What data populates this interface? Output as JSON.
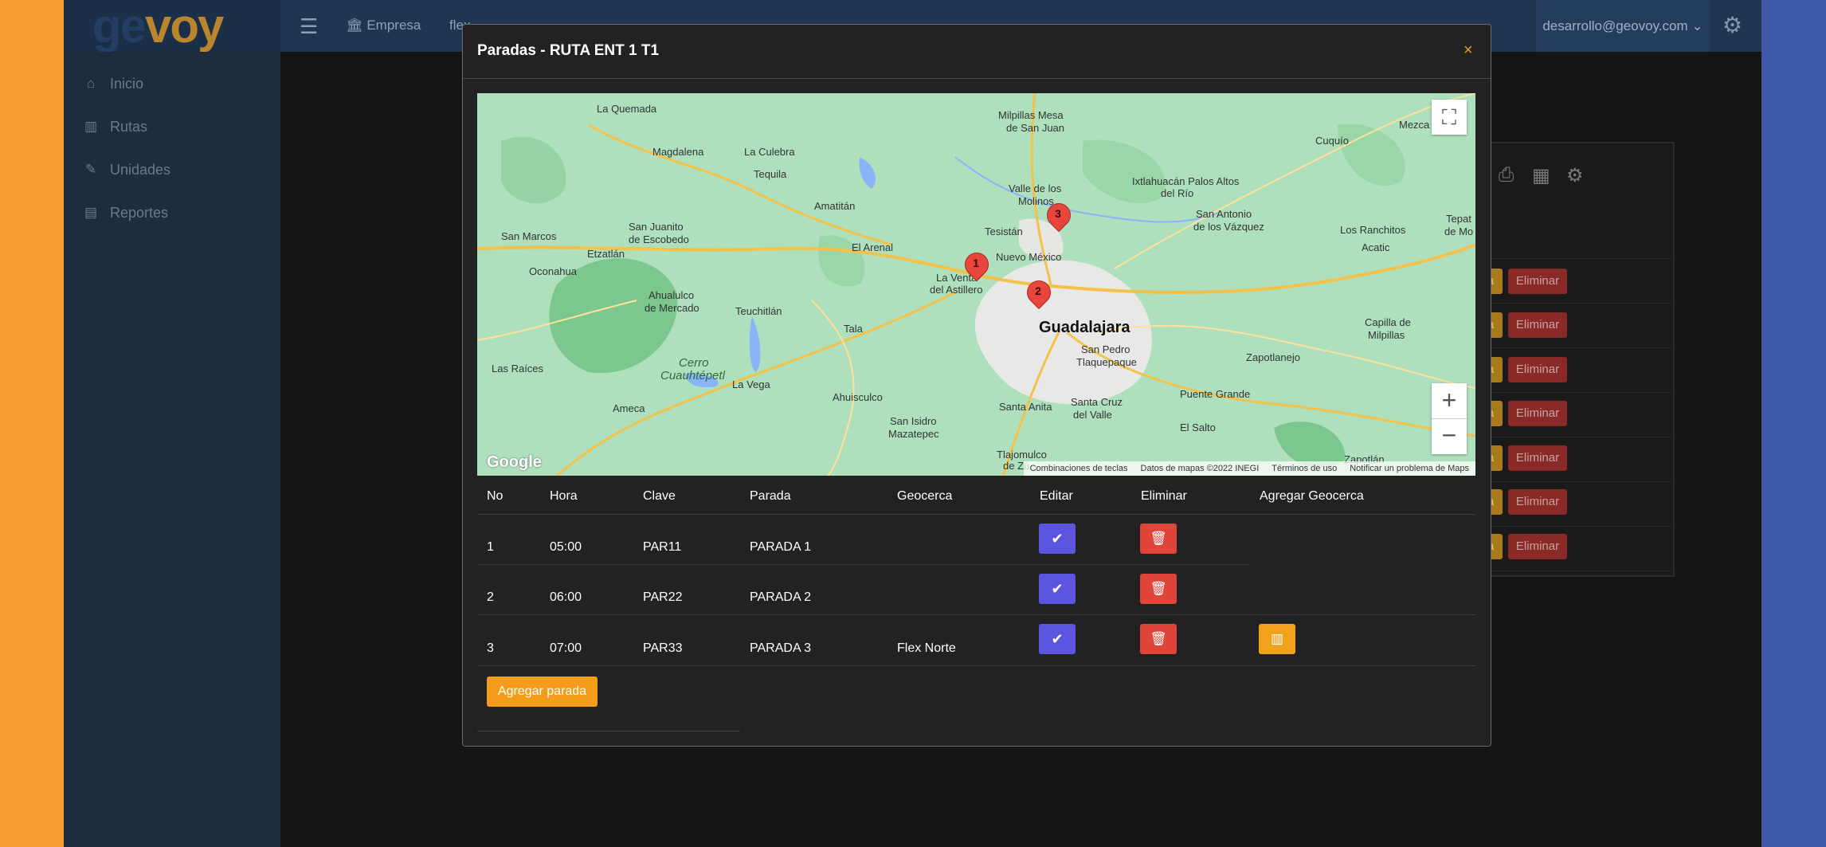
{
  "brand": {
    "logo_text_a": "ge",
    "logo_text_b": "v",
    "logo_text_c": "oy"
  },
  "topbar": {
    "empresa_label": "Empresa",
    "flex_label": "flex",
    "user_email": "desarrollo@geovoy.com",
    "user_caret": "⌄"
  },
  "sidebar": {
    "items": [
      {
        "label": "Inicio",
        "icon": "home-icon"
      },
      {
        "label": "Rutas",
        "icon": "map-icon"
      },
      {
        "label": "Unidades",
        "icon": "pencil-icon"
      },
      {
        "label": "Reportes",
        "icon": "clipboard-icon"
      }
    ]
  },
  "background_table": {
    "partial_button_label": "a",
    "delete_label": "Eliminar"
  },
  "modal": {
    "title": "Paradas - RUTA ENT 1 T1",
    "close_label": "×",
    "map": {
      "markers": [
        "1",
        "2",
        "3"
      ],
      "labels": {
        "guadalajara": "Guadalajara",
        "la_quemada": "La Quemada",
        "milpillas": "Milpillas Mesa",
        "de_san_juan": "de San Juan",
        "magdalena": "Magdalena",
        "la_culebra": "La Culebra",
        "tequila": "Tequila",
        "amatitan": "Amatitán",
        "valle_molinos": "Valle de los",
        "molinos": "Molinos",
        "ixtlahuacan": "Ixtlahuacán Palos Altos",
        "del_rio": "del Río",
        "cuquio": "Cuquío",
        "mezca": "Mezca",
        "san_juanito": "San Juanito",
        "de_escobedo": "de Escobedo",
        "san_marcos": "San Marcos",
        "etzatlan": "Etzatlán",
        "el_arenal": "El Arenal",
        "tesistan": "Tesistán",
        "nuevo_mexico": "Nuevo México",
        "san_antonio": "San Antonio",
        "de_los_vazquez": "de los Vázquez",
        "los_ranchitos": "Los Ranchitos",
        "acatic": "Acatic",
        "tepat": "Tepat",
        "de_mo": "de Mo",
        "oconahua": "Oconahua",
        "ahualulco": "Ahualulco",
        "de_mercado": "de Mercado",
        "teuchitlan": "Teuchitlán",
        "la_venta": "La Venta",
        "del_astillero": "del Astillero",
        "tala": "Tala",
        "capilla": "Capilla de",
        "milpillas2": "Milpillas",
        "san_pedro": "San Pedro",
        "tlaquepaque": "Tlaquepaque",
        "zapotlanejo": "Zapotlanejo",
        "las_raices": "Las Raíces",
        "cerro": "Cerro",
        "cuauhtepetl": "Cuauhtépetl",
        "la_vega": "La Vega",
        "ahuisculco": "Ahuisculco",
        "santa_anita": "Santa Anita",
        "santa_cruz": "Santa Cruz",
        "del_valle": "del Valle",
        "puente_grande": "Puente Grande",
        "ameca": "Ameca",
        "san_isidro": "San Isidro",
        "mazatepec": "Mazatepec",
        "el_salto": "El Salto",
        "tlajomulco": "Tlajomulco",
        "de_zuniga": "de Zú",
        "zapotlan": "Zapotlán"
      },
      "google_logo": "Google",
      "attribution": [
        "Combinaciones de teclas",
        "Datos de mapas ©2022 INEGI",
        "Términos de uso",
        "Notificar un problema de Maps"
      ],
      "zoom_in_label": "+",
      "zoom_out_label": "−",
      "fullscreen_label": "⛶"
    },
    "table": {
      "headers": [
        "No",
        "Hora",
        "Clave",
        "Parada",
        "Geocerca",
        "Editar",
        "Eliminar",
        "Agregar Geocerca"
      ],
      "rows": [
        {
          "no": "1",
          "hora": "05:00",
          "clave": "PAR11",
          "parada": "PARADA 1",
          "geocerca": ""
        },
        {
          "no": "2",
          "hora": "06:00",
          "clave": "PAR22",
          "parada": "PARADA 2",
          "geocerca": ""
        },
        {
          "no": "3",
          "hora": "07:00",
          "clave": "PAR33",
          "parada": "PARADA 3",
          "geocerca": "Flex Norte"
        }
      ]
    },
    "add_button_label": "Agregar parada"
  },
  "icons": {
    "edit": "✔",
    "delete": "🗑",
    "geofence": "▥",
    "print": "⎙",
    "excel": "▦",
    "gear": "⚙"
  }
}
